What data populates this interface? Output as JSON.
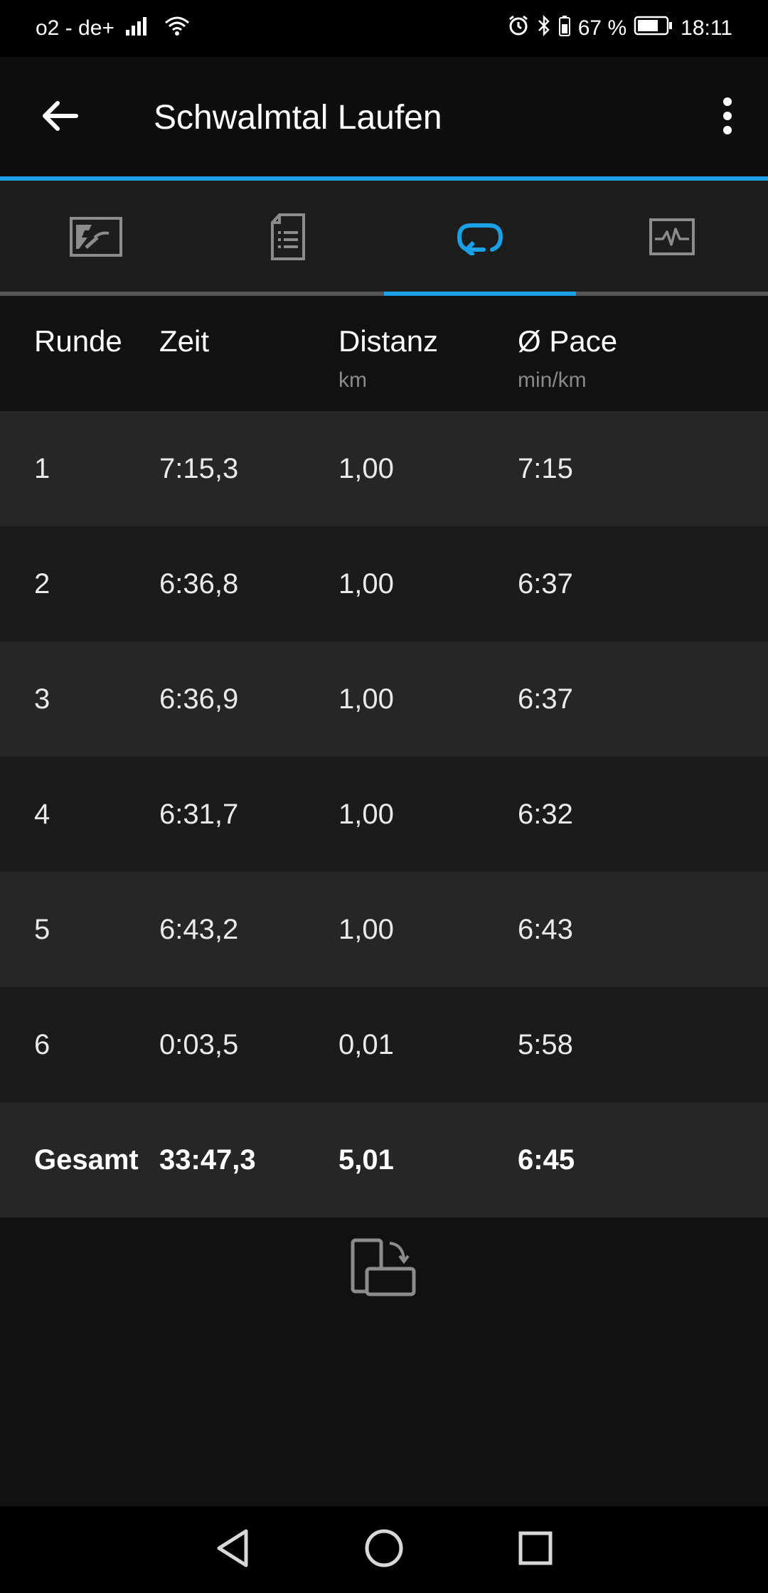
{
  "status_bar": {
    "carrier": "o2 - de+",
    "battery_percent": "67 %",
    "time": "18:11"
  },
  "app_bar": {
    "title": "Schwalmtal Laufen"
  },
  "tabs": [
    {
      "icon": "map-icon",
      "active": false
    },
    {
      "icon": "details-icon",
      "active": false
    },
    {
      "icon": "laps-icon",
      "active": true
    },
    {
      "icon": "chart-icon",
      "active": false
    }
  ],
  "table": {
    "headers": {
      "lap": "Runde",
      "time": "Zeit",
      "distance": "Distanz",
      "distance_unit": "km",
      "pace": "Ø Pace",
      "pace_unit": "min/km"
    },
    "rows": [
      {
        "lap": "1",
        "time": "7:15,3",
        "distance": "1,00",
        "pace": "7:15"
      },
      {
        "lap": "2",
        "time": "6:36,8",
        "distance": "1,00",
        "pace": "6:37"
      },
      {
        "lap": "3",
        "time": "6:36,9",
        "distance": "1,00",
        "pace": "6:37"
      },
      {
        "lap": "4",
        "time": "6:31,7",
        "distance": "1,00",
        "pace": "6:32"
      },
      {
        "lap": "5",
        "time": "6:43,2",
        "distance": "1,00",
        "pace": "6:43"
      },
      {
        "lap": "6",
        "time": "0:03,5",
        "distance": "0,01",
        "pace": "5:58"
      }
    ],
    "total": {
      "lap": "Gesamt",
      "time": "33:47,3",
      "distance": "5,01",
      "pace": "6:45"
    }
  },
  "colors": {
    "accent": "#1aa0e6",
    "background": "#111111"
  }
}
